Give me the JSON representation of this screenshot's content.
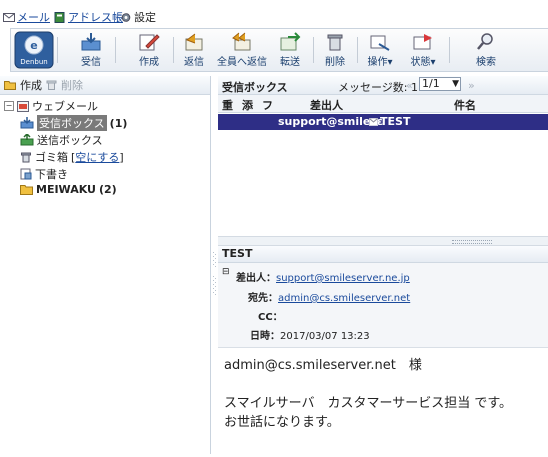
{
  "nav": {
    "mail": "メール",
    "address_book": "アドレス帳",
    "settings": "設定"
  },
  "toolbar": {
    "logo": "Denbun",
    "receive": "受信",
    "compose": "作成",
    "reply": "返信",
    "reply_all": "全員へ返信",
    "forward": "転送",
    "delete": "削除",
    "operation": "操作▾",
    "status": "状態▾",
    "search": "検索"
  },
  "folders": {
    "create": "作成",
    "delete": "削除",
    "root": "ウェブメール",
    "inbox": "受信ボックス",
    "inbox_count": "(1)",
    "sent": "送信ボックス",
    "trash": "ゴミ箱",
    "trash_empty": "空にする",
    "drafts": "下書き",
    "custom": "MEIWAKU",
    "custom_count": "(2)"
  },
  "list": {
    "folder_title": "受信ボックス",
    "message_count": "メッセージ数: 1",
    "page": "1/1",
    "columns": {
      "flag": "重",
      "attach": "添",
      "forward": "フ",
      "sender": "差出人",
      "subject": "件名"
    },
    "rows": [
      {
        "sender": "support@smilesε",
        "subject": "TEST"
      }
    ]
  },
  "preview": {
    "title": "TEST",
    "from_label": "差出人：",
    "from": "support@smileserver.ne.jp",
    "to_label": "宛先：",
    "to": "admin@cs.smileserver.net",
    "cc_label": "CC：",
    "cc": "",
    "date_label": "日時：",
    "date": "2017/03/07 13:23",
    "body_line1": "admin@cs.smileserver.net　様",
    "body_line2": "スマイルサーバ　カスタマーサービス担当 です。",
    "body_line3": "お世話になります。"
  },
  "colors": {
    "selected_row": "#2e2e86",
    "link": "#1a4a9c",
    "toolbar_label": "#1b3f6e"
  }
}
